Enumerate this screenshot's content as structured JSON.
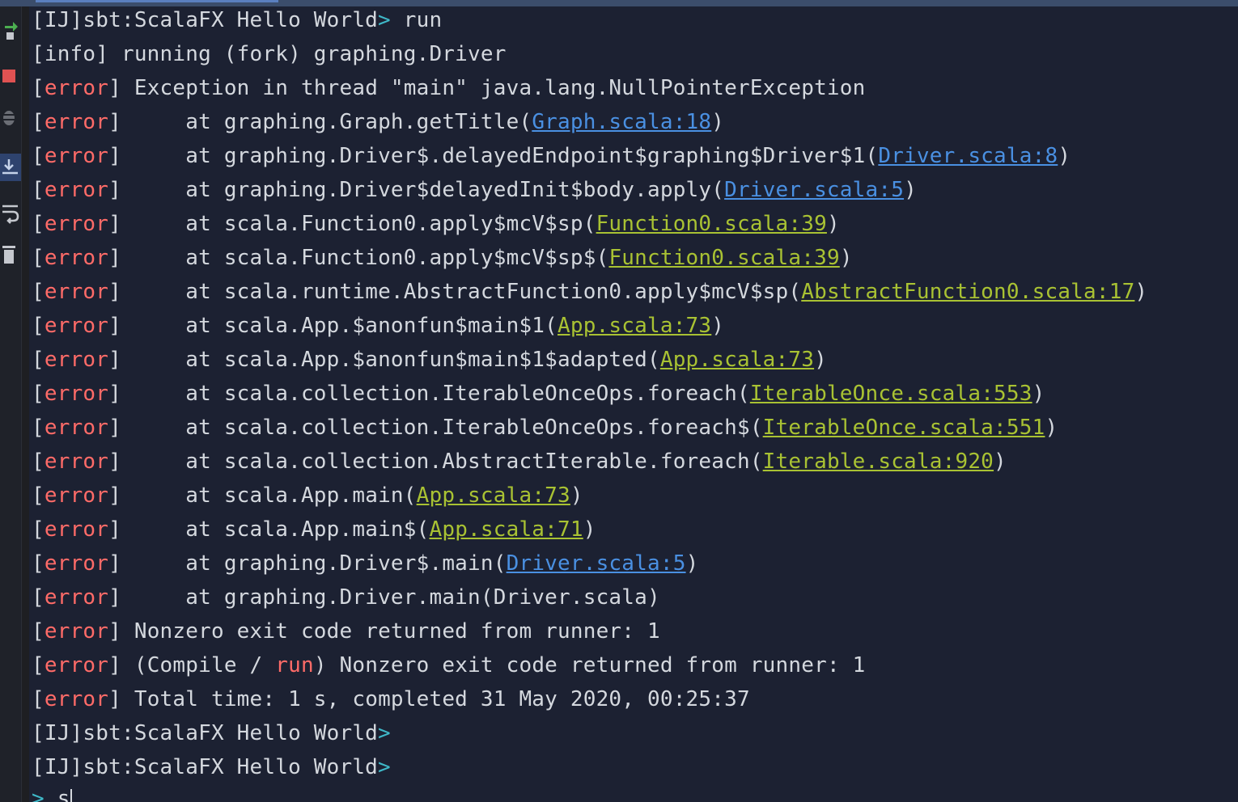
{
  "console": {
    "command_line": {
      "prompt": "[IJ]sbt:ScalaFX Hello World",
      "arrow": ">",
      "command": " run"
    },
    "info_line": {
      "prefix": "[info]",
      "text": " running (fork) graphing.Driver"
    },
    "error_tag": {
      "open": "[",
      "word": "error",
      "close": "]"
    },
    "exception_text": " Exception in thread \"main\" java.lang.NullPointerException",
    "stack": [
      {
        "text": "     at graphing.Graph.getTitle(",
        "link": "Graph.scala:18",
        "link_color": "blue",
        "tail": ")"
      },
      {
        "text": "     at graphing.Driver$.delayedEndpoint$graphing$Driver$1(",
        "link": "Driver.scala:8",
        "link_color": "blue",
        "tail": ")"
      },
      {
        "text": "     at graphing.Driver$delayedInit$body.apply(",
        "link": "Driver.scala:5",
        "link_color": "blue",
        "tail": ")"
      },
      {
        "text": "     at scala.Function0.apply$mcV$sp(",
        "link": "Function0.scala:39",
        "link_color": "green",
        "tail": ")"
      },
      {
        "text": "     at scala.Function0.apply$mcV$sp$(",
        "link": "Function0.scala:39",
        "link_color": "green",
        "tail": ")"
      },
      {
        "text": "     at scala.runtime.AbstractFunction0.apply$mcV$sp(",
        "link": "AbstractFunction0.scala:17",
        "link_color": "green",
        "tail": ")"
      },
      {
        "text": "     at scala.App.$anonfun$main$1(",
        "link": "App.scala:73",
        "link_color": "green",
        "tail": ")"
      },
      {
        "text": "     at scala.App.$anonfun$main$1$adapted(",
        "link": "App.scala:73",
        "link_color": "green",
        "tail": ")"
      },
      {
        "text": "     at scala.collection.IterableOnceOps.foreach(",
        "link": "IterableOnce.scala:553",
        "link_color": "green",
        "tail": ")"
      },
      {
        "text": "     at scala.collection.IterableOnceOps.foreach$(",
        "link": "IterableOnce.scala:551",
        "link_color": "green",
        "tail": ")"
      },
      {
        "text": "     at scala.collection.AbstractIterable.foreach(",
        "link": "Iterable.scala:920",
        "link_color": "green",
        "tail": ")"
      },
      {
        "text": "     at scala.App.main(",
        "link": "App.scala:73",
        "link_color": "green",
        "tail": ")"
      },
      {
        "text": "     at scala.App.main$(",
        "link": "App.scala:71",
        "link_color": "green",
        "tail": ")"
      },
      {
        "text": "     at graphing.Driver$.main(",
        "link": "Driver.scala:5",
        "link_color": "blue",
        "tail": ")"
      },
      {
        "text": "     at graphing.Driver.main(Driver.scala)",
        "link": "",
        "link_color": "",
        "tail": ""
      }
    ],
    "nonzero_text": " Nonzero exit code returned from runner: 1",
    "compile_line": {
      "before": " (Compile / ",
      "run": "run",
      "after": ") Nonzero exit code returned from runner: 1"
    },
    "total_time_text": " Total time: 1 s, completed 31 May 2020, 00:25:37",
    "prompt_lines": [
      {
        "prompt": "[IJ]sbt:ScalaFX Hello World",
        "arrow": ">"
      },
      {
        "prompt": "[IJ]sbt:ScalaFX Hello World",
        "arrow": ">"
      }
    ],
    "input_line": {
      "arrow": ">",
      "typed": " s"
    }
  },
  "toolbar": {
    "icons": [
      "rerun-icon",
      "stop-icon",
      "debug-icon",
      "scroll-to-end-icon",
      "soft-wrap-icon",
      "clear-icon"
    ]
  },
  "colors": {
    "background": "#1c2132",
    "text": "#d4d8de",
    "error": "#ff6b68",
    "link_blue": "#4a90e2",
    "link_green": "#a9c233",
    "prompt_arrow": "#3fb9c9"
  }
}
